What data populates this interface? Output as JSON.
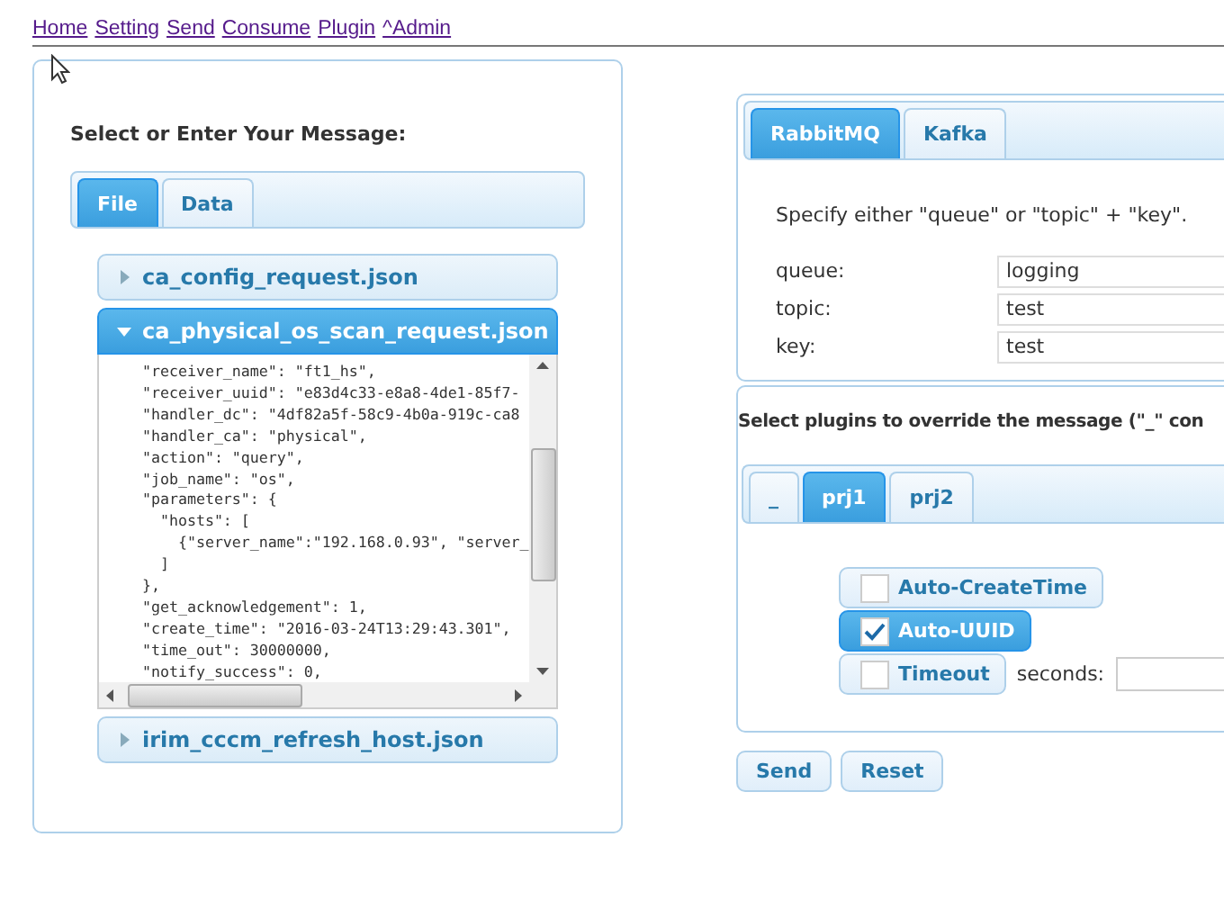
{
  "nav_links": [
    "Home",
    "Setting",
    "Send",
    "Consume",
    "Plugin",
    "^Admin"
  ],
  "message_panel": {
    "heading": "Select or Enter Your Message:",
    "tabs": [
      {
        "label": "File",
        "selected": true
      },
      {
        "label": "Data",
        "selected": false
      }
    ],
    "files": [
      {
        "name": "ca_config_request.json",
        "expanded": false
      },
      {
        "name": "ca_physical_os_scan_request.json",
        "expanded": true,
        "content": "    \"receiver_name\": \"ft1_hs\",\n    \"receiver_uuid\": \"e83d4c33-e8a8-4de1-85f7-\n    \"handler_dc\": \"4df82a5f-58c9-4b0a-919c-ca8\n    \"handler_ca\": \"physical\",\n    \"action\": \"query\",\n    \"job_name\": \"os\",\n    \"parameters\": {\n      \"hosts\": [\n        {\"server_name\":\"192.168.0.93\", \"server_\n      ]\n    },\n    \"get_acknowledgement\": 1,\n    \"create_time\": \"2016-03-24T13:29:43.301\",\n    \"time_out\": 30000000,\n    \"notify_success\": 0,"
      },
      {
        "name": "irim_cccm_refresh_host.json",
        "expanded": false
      }
    ]
  },
  "broker_panel": {
    "tabs": [
      {
        "label": "RabbitMQ",
        "selected": true
      },
      {
        "label": "Kafka",
        "selected": false
      }
    ],
    "hint": "Specify either \"queue\" or \"topic\" + \"key\".",
    "fields": [
      {
        "label": "queue:",
        "value": "logging"
      },
      {
        "label": "topic:",
        "value": "test"
      },
      {
        "label": "key:",
        "value": "test"
      }
    ]
  },
  "plugin_panel": {
    "heading": "Select plugins to override the message (\"_\" con",
    "tabs": [
      {
        "label": "_",
        "selected": false
      },
      {
        "label": "prj1",
        "selected": true
      },
      {
        "label": "prj2",
        "selected": false
      }
    ],
    "options": [
      {
        "kind": "checkbox",
        "label": "Auto-CreateTime",
        "checked": false
      },
      {
        "kind": "checkbox",
        "label": "Auto-UUID",
        "checked": true
      },
      {
        "kind": "checkbox-with-field",
        "label": "Timeout",
        "checked": false,
        "field_label": "seconds:"
      }
    ]
  },
  "buttons": [
    "Send",
    "Reset"
  ]
}
